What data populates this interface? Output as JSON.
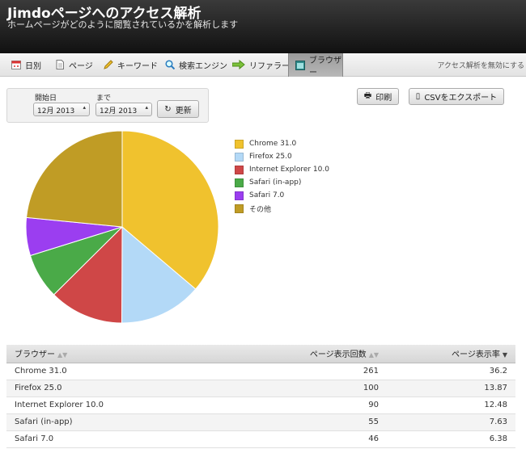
{
  "header": {
    "title": "Jimdoページへのアクセス解析",
    "subtitle": "ホームページがどのように閲覧されているかを解析します"
  },
  "tabs": [
    {
      "label": "日別",
      "icon": "calendar-icon",
      "active": false
    },
    {
      "label": "ページ",
      "icon": "page-icon",
      "active": false
    },
    {
      "label": "キーワード",
      "icon": "pencil-icon",
      "active": false
    },
    {
      "label": "検索エンジン",
      "icon": "search-icon",
      "active": false
    },
    {
      "label": "リファラー",
      "icon": "arrow-icon",
      "active": false
    },
    {
      "label": "ブラウザー",
      "icon": "browser-icon",
      "active": true
    }
  ],
  "disable_link": "アクセス解析を無効にする",
  "date_filter": {
    "start_label": "開始日",
    "end_label": "まで",
    "start_value": "12月 2013",
    "end_value": "12月 2013",
    "refresh_label": "更新"
  },
  "actions": {
    "print_label": "印刷",
    "export_label": "CSVをエクスポート"
  },
  "chart_data": {
    "type": "pie",
    "categories": [
      "Chrome 31.0",
      "Firefox 25.0",
      "Internet Explorer 10.0",
      "Safari (in-app)",
      "Safari 7.0",
      "その他"
    ],
    "values": [
      36.2,
      13.87,
      12.48,
      7.63,
      6.38,
      23.44
    ],
    "colors": [
      "#f0c22e",
      "#b3d9f7",
      "#cf4747",
      "#4aaa48",
      "#9b3ef0",
      "#c09c25"
    ],
    "legend_position": "right"
  },
  "table": {
    "headers": [
      "ブラウザー",
      "ページ表示回数",
      "ページ表示率"
    ],
    "rows": [
      [
        "Chrome 31.0",
        "261",
        "36.2"
      ],
      [
        "Firefox 25.0",
        "100",
        "13.87"
      ],
      [
        "Internet Explorer 10.0",
        "90",
        "12.48"
      ],
      [
        "Safari (in-app)",
        "55",
        "7.63"
      ],
      [
        "Safari 7.0",
        "46",
        "6.38"
      ]
    ]
  }
}
